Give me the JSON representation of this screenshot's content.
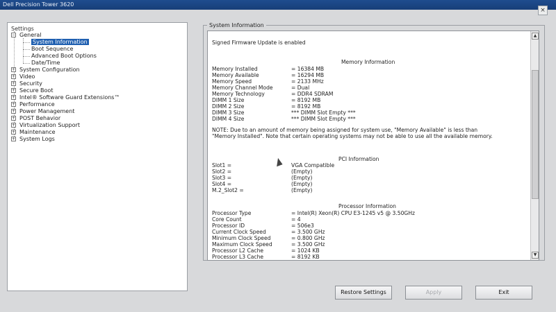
{
  "window": {
    "title": "Dell Precision Tower 3620",
    "close_glyph": "×"
  },
  "tree": {
    "root": "Settings",
    "expand_minus": "−",
    "expand_plus": "+",
    "general": "General",
    "general_children": [
      "System Information",
      "Boot Sequence",
      "Advanced Boot Options",
      "Date/Time"
    ],
    "groups": [
      "System Configuration",
      "Video",
      "Security",
      "Secure Boot",
      "Intel® Software Guard Extensions™",
      "Performance",
      "Power Management",
      "POST Behavior",
      "Virtualization Support",
      "Maintenance",
      "System Logs"
    ]
  },
  "panel": {
    "group_title": "System Information",
    "firmware": "Signed Firmware Update is enabled",
    "memory": {
      "heading": "Memory Information",
      "rows": [
        {
          "k": "Memory Installed",
          "v": "= 16384 MB"
        },
        {
          "k": "Memory Available",
          "v": "= 16294 MB"
        },
        {
          "k": "Memory Speed",
          "v": "= 2133 MHz"
        },
        {
          "k": "Memory Channel Mode",
          "v": "= Dual"
        },
        {
          "k": "Memory Technology",
          "v": "= DDR4 SDRAM"
        },
        {
          "k": "DIMM 1 Size",
          "v": "= 8192 MB"
        },
        {
          "k": "DIMM 2 Size",
          "v": "= 8192 MB"
        },
        {
          "k": "DIMM 3 Size",
          "v": "*** DIMM Slot Empty ***"
        },
        {
          "k": "DIMM 4 Size",
          "v": "*** DIMM Slot Empty ***"
        }
      ],
      "note": "NOTE: Due to an amount of memory being assigned for system use, \"Memory Available\" is less than \"Memory Installed\". Note that certain operating systems may not be able to use all the available memory."
    },
    "pci": {
      "heading": "PCI Information",
      "rows": [
        {
          "k": "Slot1 =",
          "v": "VGA Compatible"
        },
        {
          "k": "Slot2 =",
          "v": "(Empty)"
        },
        {
          "k": "Slot3 =",
          "v": "(Empty)"
        },
        {
          "k": "Slot4 =",
          "v": "(Empty)"
        },
        {
          "k": "M.2_Slot2 =",
          "v": "(Empty)"
        }
      ]
    },
    "processor": {
      "heading": "Processor Information",
      "rows": [
        {
          "k": "Processor Type",
          "v": "= Intel(R) Xeon(R) CPU E3-1245 v5 @ 3.50GHz"
        },
        {
          "k": "Core Count",
          "v": "= 4"
        },
        {
          "k": "Processor ID",
          "v": "= 506e3"
        },
        {
          "k": "Current Clock Speed",
          "v": "= 3.500 GHz"
        },
        {
          "k": "Minimum Clock Speed",
          "v": "= 0.800 GHz"
        },
        {
          "k": "Maximum Clock Speed",
          "v": "= 3.500 GHz"
        },
        {
          "k": "Processor L2 Cache",
          "v": "= 1024 KB"
        },
        {
          "k": "Processor L3 Cache",
          "v": "= 8192 KB"
        }
      ]
    },
    "scroll_up": "▲",
    "scroll_down": "▼"
  },
  "buttons": {
    "restore": "Restore Settings",
    "apply": "Apply",
    "exit": "Exit"
  }
}
